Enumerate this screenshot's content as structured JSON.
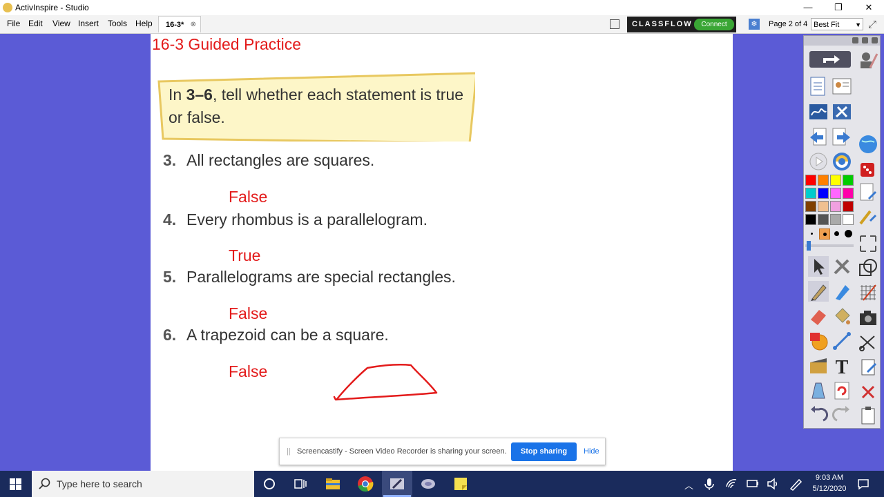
{
  "window": {
    "title": "ActivInspire - Studio",
    "minimize": "—",
    "maximize": "❐",
    "close": "✕"
  },
  "menu": [
    "File",
    "Edit",
    "View",
    "Insert",
    "Tools",
    "Help"
  ],
  "doc_tab": {
    "label": "16-3*",
    "close": "⊗"
  },
  "classflow": {
    "logo": "CLASSFLOW",
    "connect": "Connect"
  },
  "page_nav": {
    "label": "Page 2 of 4",
    "zoom": "Best Fit"
  },
  "flipchart": {
    "heading": "16-3 Guided Practice",
    "instruction_pre": "In ",
    "instruction_bold": "3–6",
    "instruction_post": ", tell whether each statement is true or false.",
    "questions": [
      {
        "num": "3.",
        "text": "All rectangles are squares.",
        "answer": "False"
      },
      {
        "num": "4.",
        "text": "Every rhombus is a parallelogram.",
        "answer": "True"
      },
      {
        "num": "5.",
        "text": "Parallelograms are special rectangles.",
        "answer": "False"
      },
      {
        "num": "6.",
        "text": "A trapezoid can be a square.",
        "answer": "False"
      }
    ]
  },
  "screencastify": {
    "grip": "||",
    "message": "Screencastify - Screen Video Recorder is sharing your screen.",
    "stop": "Stop sharing",
    "hide": "Hide"
  },
  "toolbox": {
    "colors": [
      "#ff0000",
      "#ff8000",
      "#ffff00",
      "#00cc00",
      "#00cccc",
      "#0000ff",
      "#ff66ff",
      "#ff00aa",
      "#804000",
      "#f0c090",
      "#f0a0e0",
      "#c00000",
      "#000000",
      "#555555",
      "#aaaaaa",
      "#ffffff"
    ]
  },
  "taskbar": {
    "search_placeholder": "Type here to search",
    "time": "9:03 AM",
    "date": "5/12/2020"
  },
  "colors": {
    "accent_red": "#e31b1b",
    "desktop": "#5b5bd6",
    "taskbar": "#1a2b5c"
  }
}
